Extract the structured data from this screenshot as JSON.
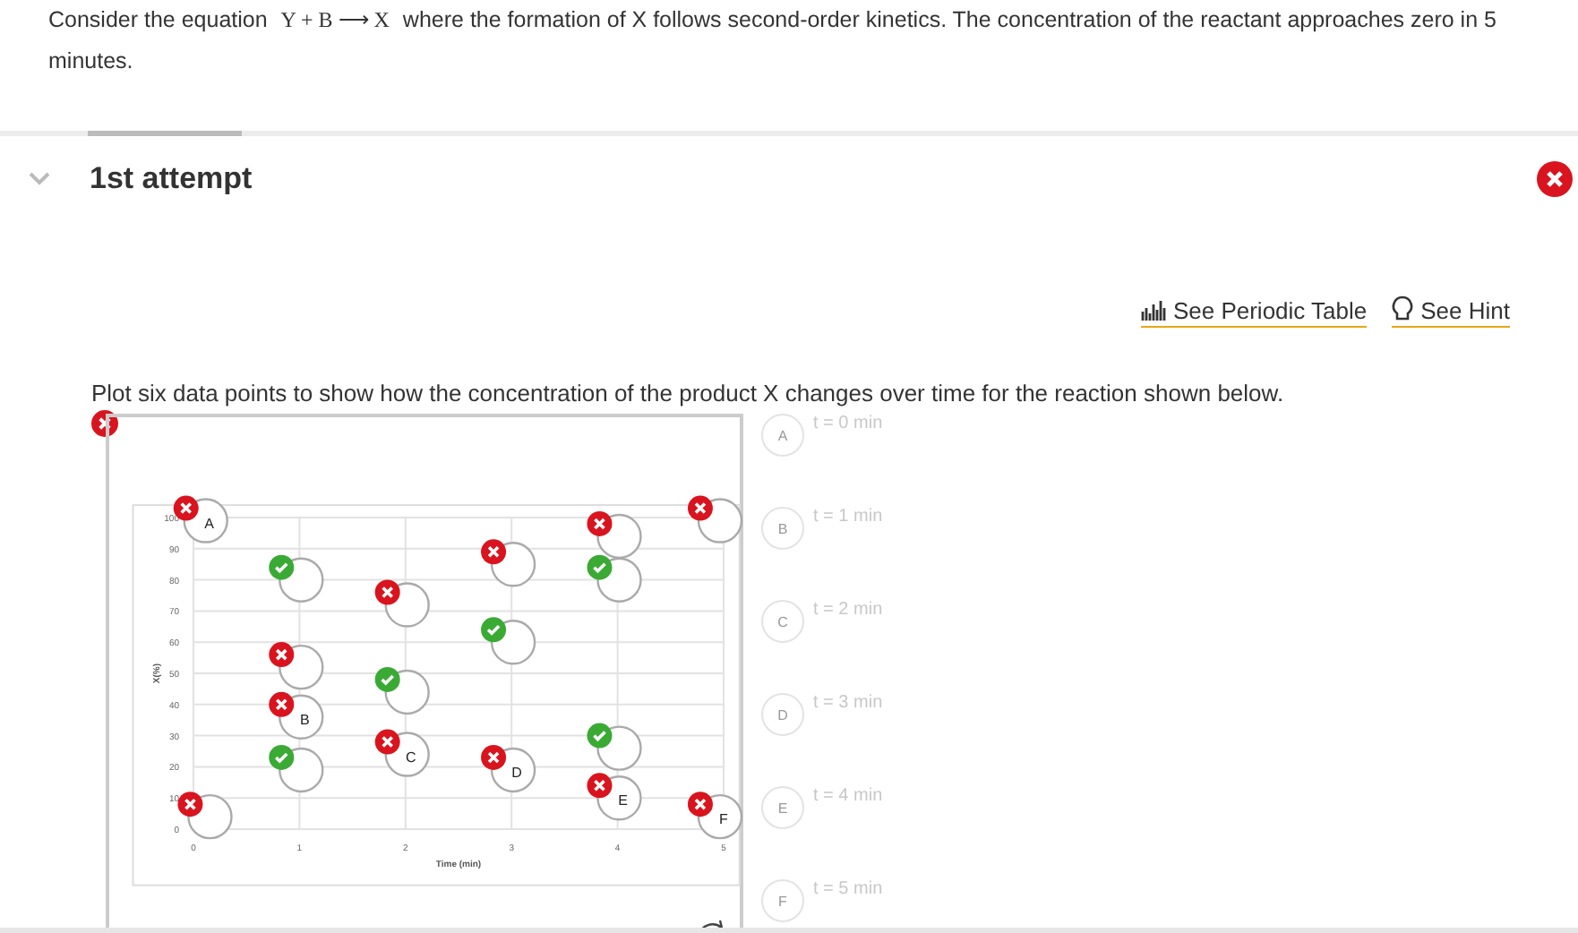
{
  "question": {
    "lead": "Consider the equation",
    "equation": "Y + B ⟶ X",
    "text": "where the formation of X follows second-order kinetics. The concentration of the reactant approaches zero in 5 minutes."
  },
  "attempt": {
    "title": "1st attempt",
    "correct": false
  },
  "links": [
    {
      "label": "See Periodic Table",
      "kind": "table"
    },
    {
      "label": "See Hint",
      "kind": "hint"
    }
  ],
  "instruction": "Plot six data points to show how the concentration of the product X changes over time for the reaction shown below.",
  "answer_correct": false,
  "graph": {
    "chart_data": {
      "type": "scatter",
      "xlabel": "Time (min)",
      "ylabel": "X(%)",
      "xlim": [
        -0.57,
        5.15
      ],
      "ylim": [
        -18,
        104
      ],
      "xticks": [
        0,
        1,
        2,
        3,
        4,
        5
      ],
      "yticks": [
        0,
        10,
        20,
        30,
        40,
        50,
        60,
        70,
        80,
        90,
        100
      ],
      "grid": true,
      "x": [
        -0.07,
        -0.03,
        0.83,
        0.83,
        0.83,
        0.83,
        1.83,
        1.83,
        1.83,
        2.83,
        2.83,
        2.83,
        3.83,
        3.83,
        3.83,
        3.83,
        4.78,
        4.78
      ],
      "series": [
        {
          "color": "#3aaa35",
          "values": [
            null,
            null,
            84,
            null,
            null,
            23,
            null,
            48,
            null,
            null,
            64,
            null,
            null,
            84,
            30,
            null,
            null,
            null
          ]
        },
        {
          "color": "#d9141e",
          "values": [
            103,
            8,
            null,
            56,
            40,
            null,
            76,
            null,
            28,
            89,
            null,
            23,
            98,
            null,
            null,
            14,
            103,
            8
          ]
        }
      ],
      "annotations": [
        {
          "x": -0.07,
          "y": 103,
          "text": "A"
        },
        {
          "x": 0.83,
          "y": 40,
          "text": "B"
        },
        {
          "x": 1.83,
          "y": 28,
          "text": "C"
        },
        {
          "x": 2.83,
          "y": 23,
          "text": "D"
        },
        {
          "x": 3.83,
          "y": 14,
          "text": "E"
        },
        {
          "x": 4.78,
          "y": 8,
          "text": "F"
        }
      ]
    }
  },
  "markers": [
    {
      "letter": "A",
      "label": "t = 0 min",
      "disabled": true
    },
    {
      "letter": "B",
      "label": "t = 1 min",
      "disabled": true
    },
    {
      "letter": "C",
      "label": "t = 2 min",
      "disabled": true
    },
    {
      "letter": "D",
      "label": "t = 3 min",
      "disabled": true
    },
    {
      "letter": "E",
      "label": "t = 4 min",
      "disabled": true
    },
    {
      "letter": "F",
      "label": "t = 5 min",
      "disabled": true
    }
  ]
}
